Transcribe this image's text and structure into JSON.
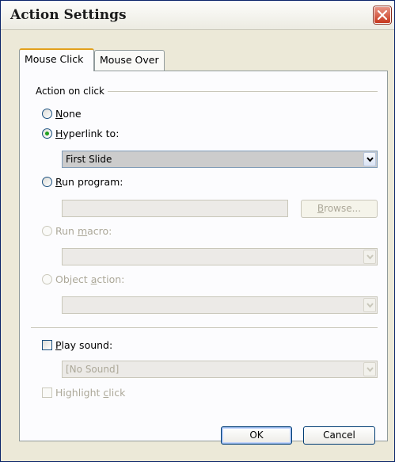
{
  "window": {
    "title": "Action Settings"
  },
  "tabs": [
    {
      "label": "Mouse Click",
      "active": true
    },
    {
      "label": "Mouse Over",
      "active": false
    }
  ],
  "action_group": {
    "label": "Action on click",
    "options": {
      "none": {
        "label_prefix": "",
        "label_underline": "N",
        "label_suffix": "one",
        "selected": false,
        "enabled": true
      },
      "hyperlink": {
        "label_prefix": "",
        "label_underline": "H",
        "label_suffix": "yperlink to:",
        "selected": true,
        "enabled": true
      },
      "run_program": {
        "label_prefix": "",
        "label_underline": "R",
        "label_suffix": "un program:",
        "selected": false,
        "enabled": true
      },
      "run_macro": {
        "label_prefix": "Run ",
        "label_underline": "m",
        "label_suffix": "acro:",
        "selected": false,
        "enabled": false
      },
      "object_action": {
        "label_prefix": "Object ",
        "label_underline": "a",
        "label_suffix": "ction:",
        "selected": false,
        "enabled": false
      }
    },
    "hyperlink_value": "First Slide",
    "run_program_value": "",
    "browse_prefix": "",
    "browse_underline": "B",
    "browse_suffix": "rowse...",
    "run_macro_value": "",
    "object_action_value": ""
  },
  "play_sound": {
    "label_prefix": "",
    "label_underline": "P",
    "label_suffix": "lay sound:",
    "checked": false,
    "value": "[No Sound]"
  },
  "highlight_click": {
    "label_prefix": "Highlight ",
    "label_underline": "c",
    "label_suffix": "lick",
    "checked": false,
    "enabled": false
  },
  "buttons": {
    "ok": "OK",
    "cancel": "Cancel"
  },
  "colors": {
    "title_text": "#1b1b1b",
    "close_red": "#c7371d",
    "tab_highlight": "#e2a11c",
    "radio_dot": "#21a121",
    "disabled_text": "#aca899"
  }
}
